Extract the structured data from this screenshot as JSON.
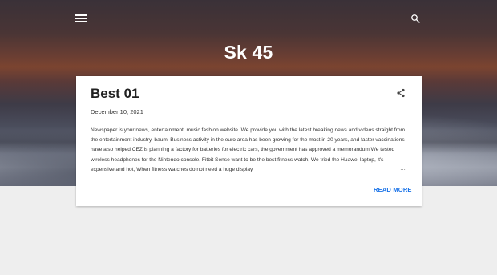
{
  "header": {
    "site_title": "Sk 45",
    "menu_icon": "hamburger-menu-icon",
    "search_icon": "search-icon"
  },
  "post": {
    "title": "Best 01",
    "date": "December 10, 2021",
    "share_icon": "share-icon",
    "snippet": "Newspaper is your news, entertainment, music fashion website. We provide you with the latest breaking news and videos straight from the entertainment industry.  baumi Business activity in the euro area has been growing for the most in 20 years, and faster vaccinations have also helped  CEZ is planning a factory for batteries for electric cars, the government has approved a memorandum We tested wireless headphones for the Nintendo console, Fitbit Sense want to be the best fitness watch, We tried the Huawei laptop, it's expensive and hot, When fitness watches do not need a huge display",
    "ellipsis": "…",
    "read_more": "READ MORE"
  },
  "colors": {
    "accent": "#1a73e8",
    "card_bg": "#ffffff",
    "page_bg": "#eeeeee"
  }
}
